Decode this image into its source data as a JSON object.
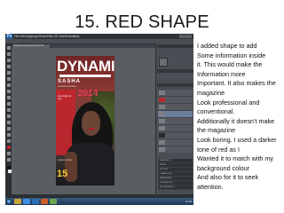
{
  "slide": {
    "title": "15. RED SHAPE"
  },
  "app": {
    "logo": "Ps",
    "menu": [
      "File",
      "Edit",
      "Image",
      "Layer",
      "Select",
      "Filter",
      "3D",
      "View",
      "Window",
      "Help"
    ],
    "doc_tab": "dynamic-cover.psd @ 16.7%",
    "panels": [
      "Swatches",
      "Adjustments",
      "Layers"
    ],
    "layer_panel_items": [
      "CHANNELS",
      "PATHS",
      "HISTORY",
      "CHARACTER",
      "PARAGRAPH",
      "PROPERTIES",
      "ADJUSTMENTS"
    ],
    "clock": "14:32",
    "accent_color": "#c0252b"
  },
  "magazine": {
    "masthead": "DYNAMIC",
    "cover_name": "SASHA",
    "cover_sub": "exclusive interview",
    "year": "2014",
    "cover_line_left": "new single out now",
    "cover_line_bottom": "top tips to fame",
    "number": "15"
  },
  "caption_lines": [
    "I added shape to add",
    "Some information inside",
    "it. This would make the",
    "Information more",
    "Important. It also makes the",
    "magazine",
    "Look professional and",
    "conventional.",
    "Additionally it doesn’t make",
    "the magazine",
    "Look boring. I used a darker",
    "tone of red as I",
    "Wanted it to match with my",
    "background colour",
    "And also for it to seek",
    "attention."
  ]
}
